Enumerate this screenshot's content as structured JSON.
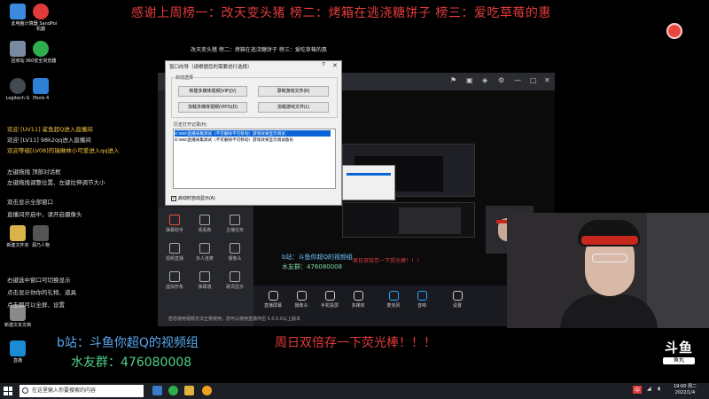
{
  "banner": {
    "thanks_text": "感谢上周榜一：改天变头猪 榜二：烤箱在逃浇糖饼子 榜三：爱吃草莓的惠"
  },
  "desktop_icons": [
    {
      "label": "此电脑",
      "color": "#3a8be0"
    },
    {
      "label": "计算器 SandPoi机器",
      "color": "#e03a3a"
    },
    {
      "label": "回收站",
      "color": "#7a8aa0"
    },
    {
      "label": "360安全浏览器",
      "color": "#2fae4e"
    },
    {
      "label": "Logitech G",
      "color": "#444a52"
    },
    {
      "label": "iTools 4",
      "color": "#2d7fd8"
    },
    {
      "label": "新建文件夹",
      "color": "#d9b34a"
    },
    {
      "label": "源乃人物",
      "color": "#555"
    },
    {
      "label": "新建文本文档",
      "color": "#8a8a8a"
    },
    {
      "label": "直播",
      "color": "#1b8bd6"
    }
  ],
  "chat_lines": [
    {
      "text": "欢迎 [UV11] 鲨鱼超Q进入直播间",
      "highlight": true
    },
    {
      "text": "欢迎 [LV11] 98k2qq进入直播间",
      "highlight": false
    },
    {
      "text": "欢迎等级[LV08]的瑞琳林小可爱进入qq进入",
      "highlight": true
    },
    {
      "text": "左键拖拽 顶部对话框",
      "highlight": false
    },
    {
      "text": "左键拖拽调整位置、左键拉伸调节大小",
      "highlight": false
    },
    {
      "text": "双击显示全部窗口",
      "highlight": false
    },
    {
      "text": "直播间开启中，请开启摄像头",
      "highlight": false
    },
    {
      "text": "右键选中窗口可切换显示",
      "highlight": false
    },
    {
      "text": "点击显示你你的礼物、道具",
      "highlight": false
    },
    {
      "text": "点击即可以全屏、设置",
      "highlight": false
    }
  ],
  "dialog": {
    "title": "窗口向导（请根据您的需要进行选择）",
    "group1_label": "启动选择",
    "buttons": [
      "新建多媒体视频(VIP)(V)",
      "录制游戏文件(R)",
      "加载多媒体视频(VIP2)(D)",
      "加载游戏文件(L)"
    ],
    "group2_label": "历史打开记录(H)",
    "list_items": [
      "D:\\WE\\直播采集调试（不可删除不可移动）游戏效果显示调试",
      "D:\\WE\\直播采集调试（不可删除不可移动）游戏效果显示调试备份"
    ],
    "checkbox_label": "启动时自动显示(A)",
    "checkbox_checked": true
  },
  "app": {
    "preview_title": "改天变头猪 榜二：烤箱在逃浇糖饼子 榜三：爱吃草莓的惠",
    "sidebar_items": [
      "弹幕助手",
      "观看数",
      "主播任务",
      "视频直播",
      "多人连麦",
      "摄像头",
      "虚拟形象",
      "弹幕墙",
      "歌词显示"
    ],
    "toolbar_items": [
      "直播屏幕",
      "摄像头",
      "手机投屏",
      "多媒体",
      "麦克风",
      "音响",
      "设置"
    ],
    "overlay_b": "b站：斗鱼你超Q的视频组",
    "overlay_qq": "水友群：476080008",
    "overlay_red": "周日双倍存一下荧光棒！！！",
    "status_text": "若您使用视频无法正常使用，您可以使用直播伴侣 5.0.0.0以上版本",
    "start_label": "开始直播"
  },
  "bottom_overlay": {
    "b_zhan": "b站：斗鱼你超Q的视频组",
    "qq_group": "水友群：476080008",
    "sunday": "周日双倍存一下荧光棒！！！"
  },
  "logo": {
    "big": "斗鱼",
    "small": "鱼丸"
  },
  "taskbar": {
    "search_placeholder": "在这里输入你要搜索的内容",
    "clock_time": "19:00 周二",
    "clock_date": "2022/1/4",
    "tray_text": "中"
  }
}
